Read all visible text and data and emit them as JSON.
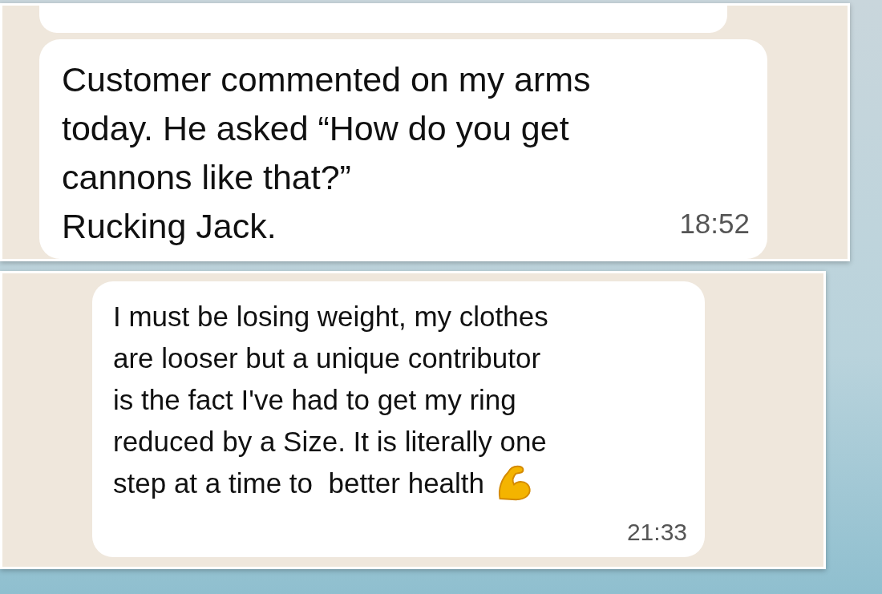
{
  "screenshots": [
    {
      "previous_bubble": true,
      "message": {
        "text": "Customer commented on my arms\ntoday. He asked “How do you get\ncannons like that?”\nRucking Jack.",
        "time": "18:52",
        "emoji_after": false
      }
    },
    {
      "previous_bubble": false,
      "message": {
        "text": "I must be losing weight, my clothes\nare looser but a unique contributor\nis the fact I've had to get my ring\nreduced by a Size. It is literally one\nstep at a time to  better health",
        "time": "21:33",
        "emoji_after": true
      }
    }
  ]
}
